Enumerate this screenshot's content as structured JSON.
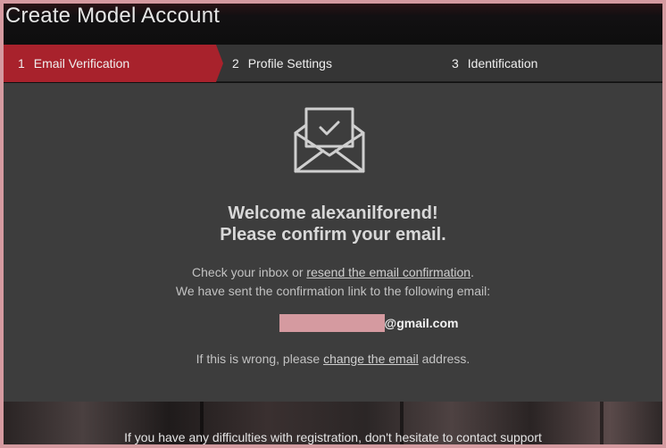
{
  "window": {
    "title": "Create Model Account"
  },
  "steps": [
    {
      "num": "1",
      "label": "Email Verification"
    },
    {
      "num": "2",
      "label": "Profile Settings"
    },
    {
      "num": "3",
      "label": "Identification"
    }
  ],
  "colors": {
    "active_step": "#a8222c",
    "panel": "#3d3d3d",
    "frame_border": "#d59aa0"
  },
  "icon": {
    "name": "envelope-check-icon"
  },
  "welcome": {
    "line1": "Welcome alexanilforend!",
    "line2": "Please confirm your email."
  },
  "message": {
    "check_prefix": "Check your inbox or ",
    "resend_link": "resend the email confirmation",
    "check_suffix": ".",
    "sent_line": "We have sent the confirmation link to the following email:"
  },
  "email": {
    "domain": "@gmail.com"
  },
  "wrong": {
    "prefix": "If this is wrong, please ",
    "link": "change the email",
    "suffix": " address."
  },
  "footer": {
    "note": "If you have any difficulties with registration, don't hesitate to contact support"
  }
}
